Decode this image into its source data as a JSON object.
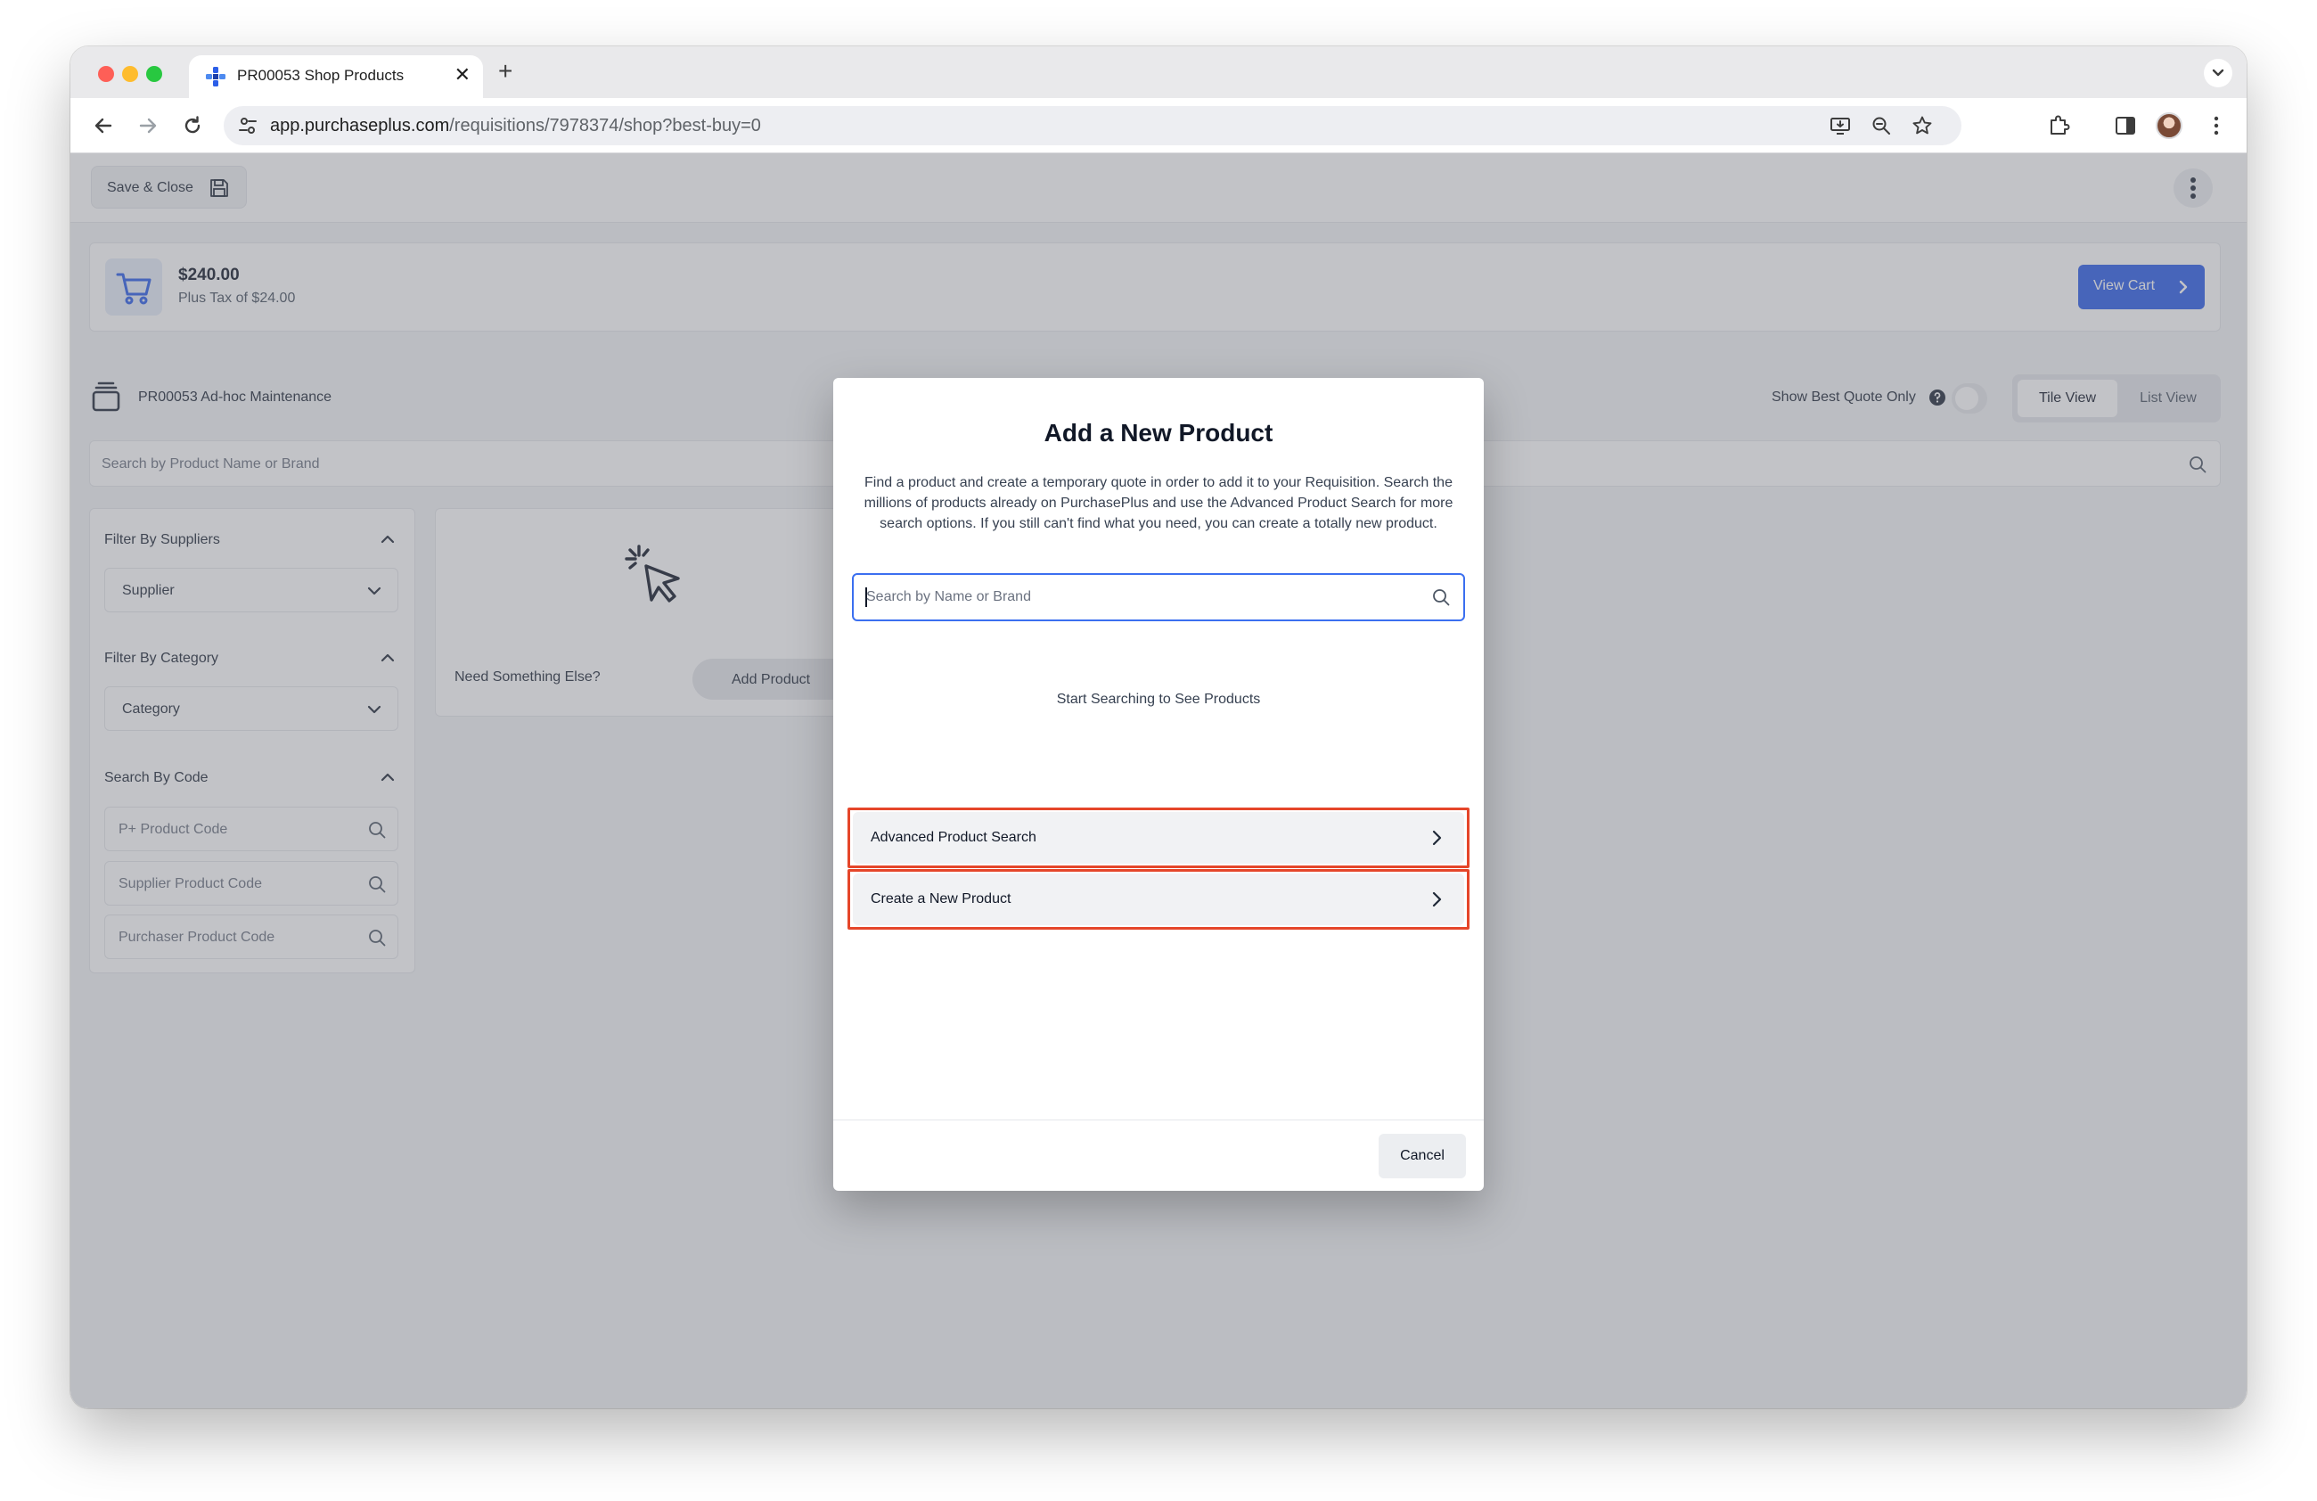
{
  "browser": {
    "tab_title": "PR00053 Shop Products",
    "tab_close": "✕",
    "new_tab": "+",
    "url_host": "app.purchaseplus.com",
    "url_path": "/requisitions/7978374/shop?best-buy=0"
  },
  "topbar": {
    "save_close_label": "Save & Close"
  },
  "cart": {
    "amount": "$240.00",
    "tax": "Plus Tax of $24.00",
    "view_cart_label": "View Cart"
  },
  "requisition": {
    "title": "PR00053 Ad-hoc Maintenance",
    "best_quote_label": "Show Best Quote Only",
    "best_quote_enabled": false,
    "view_options": [
      "Tile View",
      "List View"
    ],
    "active_view": "Tile View"
  },
  "main_search": {
    "placeholder": "Search by Product Name or Brand"
  },
  "filters": {
    "suppliers_heading": "Filter By Suppliers",
    "supplier_select": "Supplier",
    "category_heading": "Filter By Category",
    "category_select": "Category",
    "code_heading": "Search By Code",
    "code_inputs": [
      "P+ Product Code",
      "Supplier Product Code",
      "Purchaser Product Code"
    ]
  },
  "add_card": {
    "prompt": "Need Something Else?",
    "button_label": "Add Product"
  },
  "modal": {
    "title": "Add a New Product",
    "description": "Find a product and create a temporary quote in order to add it to your Requisition. Search the millions of products already on PurchasePlus and use the Advanced Product Search for more search options. If you still can't find what you need, you can create a totally new product.",
    "search_placeholder": "Search by Name or Brand",
    "empty_state": "Start Searching to See Products",
    "options": [
      "Advanced Product Search",
      "Create a New Product"
    ],
    "cancel_label": "Cancel",
    "highlight_color": "#e5462a"
  },
  "colors": {
    "accent": "#2c5ee8",
    "focus": "#3b6ff0"
  }
}
